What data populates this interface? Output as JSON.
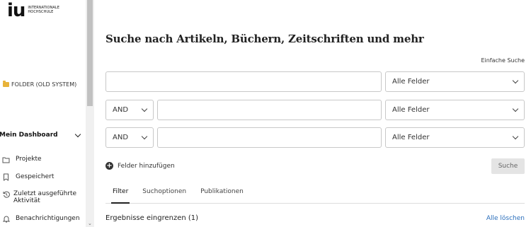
{
  "logo": {
    "mark": "iu",
    "line1": "INTERNATIONALE",
    "line2": "HOCHSCHULE"
  },
  "sidebar": {
    "folder_label": "FOLDER (OLD SYSTEM)",
    "dashboard_label": "Mein Dashboard",
    "items": [
      {
        "label": "Projekte",
        "icon": "folder-outline-icon"
      },
      {
        "label": "Gespeichert",
        "icon": "bookmark-icon"
      },
      {
        "label": "Zuletzt ausgeführte",
        "label2": "Aktivität",
        "icon": "history-icon"
      },
      {
        "label": "Benachrichtigungen",
        "icon": "bell-icon"
      }
    ]
  },
  "main": {
    "title": "Suche nach Artikeln, Büchern, Zeitschriften und mehr",
    "simple_search_link": "Einfache Suche",
    "rows": [
      {
        "field": "Alle Felder"
      },
      {
        "operator": "AND",
        "field": "Alle Felder"
      },
      {
        "operator": "AND",
        "field": "Alle Felder"
      }
    ],
    "add_fields_label": "Felder hinzufügen",
    "search_button": "Suche",
    "tabs": [
      "Filter",
      "Suchoptionen",
      "Publikationen"
    ],
    "refine_label": "Ergebnisse eingrenzen (1)",
    "clear_all_label": "Alle löschen"
  },
  "colors": {
    "link": "#2a6ebb",
    "folder": "#e8b33a"
  }
}
